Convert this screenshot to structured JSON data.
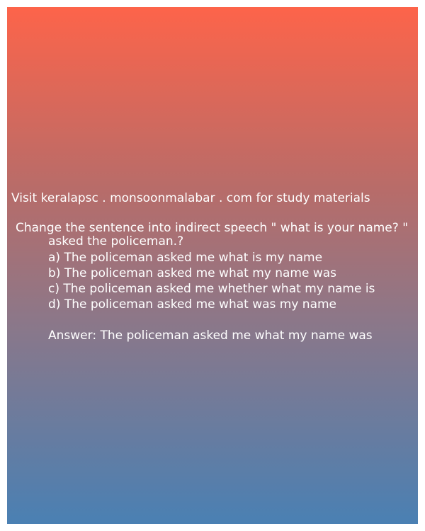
{
  "background": {
    "gradient_top": "#fd644a",
    "gradient_bottom": "#4a80b3"
  },
  "visit_text": "Visit keralapsc . monsoonmalabar . com for study materials",
  "question": {
    "line1": "Change the sentence into indirect speech \" what is your name? \"",
    "line2": "asked the policeman.?"
  },
  "options": [
    "a) The policeman asked me what is my name",
    "b) The policeman asked me what my name was",
    "c) The policeman asked me whether what my name is",
    "d) The policeman asked me what was my name"
  ],
  "answer": "Answer: The policeman asked me what my name was"
}
